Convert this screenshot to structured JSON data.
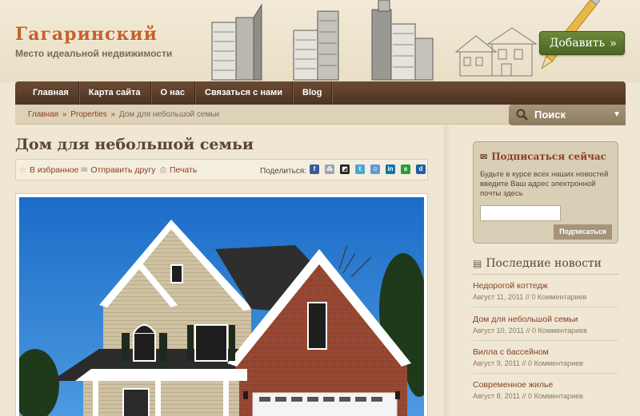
{
  "header": {
    "site_title": "Гагаринский",
    "tagline": "Место идеальной недвижимости",
    "add_button": "Добавить",
    "add_button_arrows": "»"
  },
  "nav": {
    "items": [
      {
        "label": "Главная"
      },
      {
        "label": "Карта сайта"
      },
      {
        "label": "О нас"
      },
      {
        "label": "Связаться с нами"
      },
      {
        "label": "Blog"
      }
    ]
  },
  "breadcrumb": {
    "items": [
      "Главная",
      "Properties"
    ],
    "separator": "»",
    "current": "Дом для небольшой семьи"
  },
  "search": {
    "label": "Поиск"
  },
  "main": {
    "title": "Дом для небольшой семьи",
    "actions": {
      "favorite": "В избранное",
      "send": "Отправить другу",
      "print": "Печать",
      "share": "Поделиться:"
    },
    "share_icons": [
      {
        "name": "facebook-icon",
        "glyph": "f",
        "color": "#3b5998"
      },
      {
        "name": "myspace-icon",
        "glyph": "⁂",
        "color": "#9aa4b0"
      },
      {
        "name": "delicious-icon",
        "glyph": "◩",
        "color": "#222222"
      },
      {
        "name": "twitter-icon",
        "glyph": "t",
        "color": "#4aa7d8"
      },
      {
        "name": "reddit-icon",
        "glyph": "☺",
        "color": "#5f99cf"
      },
      {
        "name": "linkedin-icon",
        "glyph": "in",
        "color": "#0e76a8"
      },
      {
        "name": "stumbleupon-icon",
        "glyph": "s",
        "color": "#2e9a36"
      },
      {
        "name": "digg-icon",
        "glyph": "d",
        "color": "#1d5fa5"
      }
    ]
  },
  "sidebar": {
    "subscribe": {
      "title": "Подписаться сейчас",
      "description": "Будьте в курсе всех наших новостей введите Ваш адрес электронной почты здесь",
      "input_value": "",
      "button": "Подписаться"
    },
    "news": {
      "title": "Последние новости",
      "items": [
        {
          "title": "Недорогой коттедж",
          "date": "Август 11, 2011",
          "sep": "//",
          "comments": "0 Комментариев"
        },
        {
          "title": "Дом для небольшой семьи",
          "date": "Август 10, 2011",
          "sep": "//",
          "comments": "0 Комментариев"
        },
        {
          "title": "Вилла с бассейном",
          "date": "Август 9, 2011",
          "sep": "//",
          "comments": "0 Комментариев"
        },
        {
          "title": "Современное жилье",
          "date": "Август 8, 2011",
          "sep": "//",
          "comments": "0 Комментариев"
        }
      ]
    }
  },
  "colors": {
    "background": "#efe7d3",
    "nav": "#5c3d29",
    "accent": "#8c3d1f",
    "logo": "#c4622b",
    "add_button": "#5b7a2b"
  }
}
